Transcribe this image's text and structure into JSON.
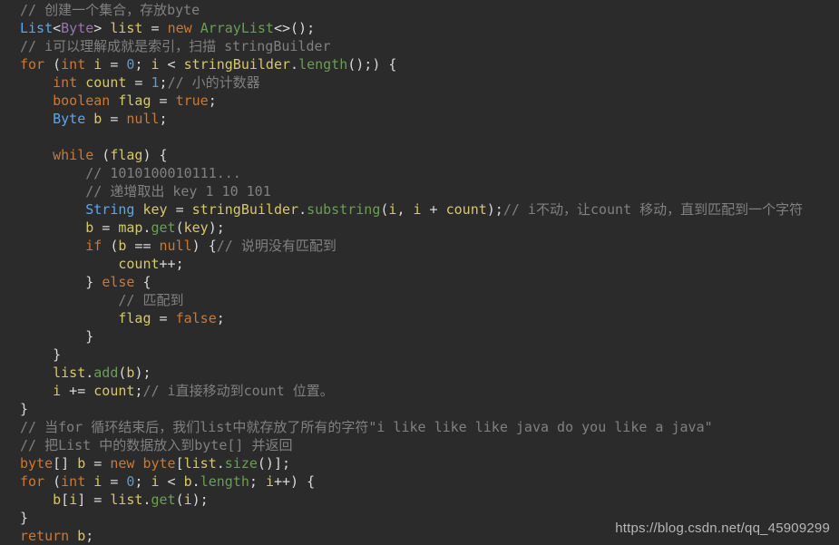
{
  "editor": {
    "background_color": "#2b2b2b",
    "language": "java",
    "theme": "darcula",
    "colors": {
      "comment": "#808080",
      "keyword": "#cc7832",
      "type": "#5ea6ea",
      "generic": "#9876aa",
      "identifier": "#d6c86a",
      "method": "#6a9e55",
      "number": "#6897bb",
      "punctuation": "#d9d9d9",
      "plain": "#a9b7c6"
    },
    "lines": [
      {
        "n": 1,
        "indent": 0,
        "tokens": [
          {
            "c": "comment",
            "t": "// 创建一个集合，存放byte"
          }
        ]
      },
      {
        "n": 2,
        "indent": 0,
        "tokens": [
          {
            "c": "type",
            "t": "List"
          },
          {
            "c": "punct",
            "t": "<"
          },
          {
            "c": "generic",
            "t": "Byte"
          },
          {
            "c": "punct",
            "t": "> "
          },
          {
            "c": "ident",
            "t": "list"
          },
          {
            "c": "op",
            "t": " = "
          },
          {
            "c": "keyword",
            "t": "new"
          },
          {
            "c": "plain",
            "t": " "
          },
          {
            "c": "method",
            "t": "ArrayList"
          },
          {
            "c": "punct",
            "t": "<>();"
          }
        ]
      },
      {
        "n": 3,
        "indent": 0,
        "tokens": [
          {
            "c": "comment",
            "t": "// i可以理解成就是索引，扫描 stringBuilder"
          }
        ]
      },
      {
        "n": 4,
        "indent": 0,
        "tokens": [
          {
            "c": "keyword",
            "t": "for"
          },
          {
            "c": "punct",
            "t": " ("
          },
          {
            "c": "keyword",
            "t": "int"
          },
          {
            "c": "plain",
            "t": " "
          },
          {
            "c": "ident",
            "t": "i"
          },
          {
            "c": "op",
            "t": " = "
          },
          {
            "c": "number",
            "t": "0"
          },
          {
            "c": "punct",
            "t": "; "
          },
          {
            "c": "ident",
            "t": "i"
          },
          {
            "c": "op",
            "t": " < "
          },
          {
            "c": "ident",
            "t": "stringBuilder"
          },
          {
            "c": "punct",
            "t": "."
          },
          {
            "c": "method",
            "t": "length"
          },
          {
            "c": "punct",
            "t": "();) {"
          }
        ]
      },
      {
        "n": 5,
        "indent": 1,
        "tokens": [
          {
            "c": "keyword",
            "t": "int"
          },
          {
            "c": "plain",
            "t": " "
          },
          {
            "c": "ident",
            "t": "count"
          },
          {
            "c": "op",
            "t": " = "
          },
          {
            "c": "number",
            "t": "1"
          },
          {
            "c": "punct",
            "t": ";"
          },
          {
            "c": "comment",
            "t": "// 小的计数器"
          }
        ]
      },
      {
        "n": 6,
        "indent": 1,
        "tokens": [
          {
            "c": "keyword",
            "t": "boolean"
          },
          {
            "c": "plain",
            "t": " "
          },
          {
            "c": "ident",
            "t": "flag"
          },
          {
            "c": "op",
            "t": " = "
          },
          {
            "c": "keyword",
            "t": "true"
          },
          {
            "c": "punct",
            "t": ";"
          }
        ]
      },
      {
        "n": 7,
        "indent": 1,
        "tokens": [
          {
            "c": "type",
            "t": "Byte"
          },
          {
            "c": "plain",
            "t": " "
          },
          {
            "c": "ident",
            "t": "b"
          },
          {
            "c": "op",
            "t": " = "
          },
          {
            "c": "keyword",
            "t": "null"
          },
          {
            "c": "punct",
            "t": ";"
          }
        ]
      },
      {
        "n": 8,
        "indent": 0,
        "tokens": []
      },
      {
        "n": 9,
        "indent": 1,
        "tokens": [
          {
            "c": "keyword",
            "t": "while"
          },
          {
            "c": "punct",
            "t": " ("
          },
          {
            "c": "ident",
            "t": "flag"
          },
          {
            "c": "punct",
            "t": ") {"
          }
        ]
      },
      {
        "n": 10,
        "indent": 2,
        "tokens": [
          {
            "c": "comment",
            "t": "// 1010100010111..."
          }
        ]
      },
      {
        "n": 11,
        "indent": 2,
        "tokens": [
          {
            "c": "comment",
            "t": "// 递增取出 key 1 10 101"
          }
        ]
      },
      {
        "n": 12,
        "indent": 2,
        "tokens": [
          {
            "c": "type",
            "t": "String"
          },
          {
            "c": "plain",
            "t": " "
          },
          {
            "c": "ident",
            "t": "key"
          },
          {
            "c": "op",
            "t": " = "
          },
          {
            "c": "ident",
            "t": "stringBuilder"
          },
          {
            "c": "punct",
            "t": "."
          },
          {
            "c": "method",
            "t": "substring"
          },
          {
            "c": "punct",
            "t": "("
          },
          {
            "c": "ident",
            "t": "i"
          },
          {
            "c": "punct",
            "t": ", "
          },
          {
            "c": "ident",
            "t": "i"
          },
          {
            "c": "op",
            "t": " + "
          },
          {
            "c": "ident",
            "t": "count"
          },
          {
            "c": "punct",
            "t": ");"
          },
          {
            "c": "comment",
            "t": "// i不动，让count 移动，直到匹配到一个字符"
          }
        ]
      },
      {
        "n": 13,
        "indent": 2,
        "tokens": [
          {
            "c": "ident",
            "t": "b"
          },
          {
            "c": "op",
            "t": " = "
          },
          {
            "c": "ident",
            "t": "map"
          },
          {
            "c": "punct",
            "t": "."
          },
          {
            "c": "method",
            "t": "get"
          },
          {
            "c": "punct",
            "t": "("
          },
          {
            "c": "ident",
            "t": "key"
          },
          {
            "c": "punct",
            "t": ");"
          }
        ]
      },
      {
        "n": 14,
        "indent": 2,
        "tokens": [
          {
            "c": "keyword",
            "t": "if"
          },
          {
            "c": "punct",
            "t": " ("
          },
          {
            "c": "ident",
            "t": "b"
          },
          {
            "c": "op",
            "t": " == "
          },
          {
            "c": "keyword",
            "t": "null"
          },
          {
            "c": "punct",
            "t": ") {"
          },
          {
            "c": "comment",
            "t": "// 说明没有匹配到"
          }
        ]
      },
      {
        "n": 15,
        "indent": 3,
        "tokens": [
          {
            "c": "ident",
            "t": "count"
          },
          {
            "c": "op",
            "t": "++"
          },
          {
            "c": "punct",
            "t": ";"
          }
        ]
      },
      {
        "n": 16,
        "indent": 2,
        "tokens": [
          {
            "c": "punct",
            "t": "} "
          },
          {
            "c": "keyword",
            "t": "else"
          },
          {
            "c": "punct",
            "t": " {"
          }
        ]
      },
      {
        "n": 17,
        "indent": 3,
        "tokens": [
          {
            "c": "comment",
            "t": "// 匹配到"
          }
        ]
      },
      {
        "n": 18,
        "indent": 3,
        "tokens": [
          {
            "c": "ident",
            "t": "flag"
          },
          {
            "c": "op",
            "t": " = "
          },
          {
            "c": "keyword",
            "t": "false"
          },
          {
            "c": "punct",
            "t": ";"
          }
        ]
      },
      {
        "n": 19,
        "indent": 2,
        "tokens": [
          {
            "c": "punct",
            "t": "}"
          }
        ]
      },
      {
        "n": 20,
        "indent": 1,
        "tokens": [
          {
            "c": "punct",
            "t": "}"
          }
        ]
      },
      {
        "n": 21,
        "indent": 1,
        "tokens": [
          {
            "c": "ident",
            "t": "list"
          },
          {
            "c": "punct",
            "t": "."
          },
          {
            "c": "method",
            "t": "add"
          },
          {
            "c": "punct",
            "t": "("
          },
          {
            "c": "ident",
            "t": "b"
          },
          {
            "c": "punct",
            "t": ");"
          }
        ]
      },
      {
        "n": 22,
        "indent": 1,
        "tokens": [
          {
            "c": "ident",
            "t": "i"
          },
          {
            "c": "op",
            "t": " += "
          },
          {
            "c": "ident",
            "t": "count"
          },
          {
            "c": "punct",
            "t": ";"
          },
          {
            "c": "comment",
            "t": "// i直接移动到count 位置。"
          }
        ]
      },
      {
        "n": 23,
        "indent": 0,
        "tokens": [
          {
            "c": "punct",
            "t": "}"
          }
        ]
      },
      {
        "n": 24,
        "indent": 0,
        "tokens": [
          {
            "c": "comment",
            "t": "// 当for 循环结束后，我们list中就存放了所有的字符\"i like like like java do you like a java\""
          }
        ]
      },
      {
        "n": 25,
        "indent": 0,
        "tokens": [
          {
            "c": "comment",
            "t": "// 把List 中的数据放入到byte[] 并返回"
          }
        ]
      },
      {
        "n": 26,
        "indent": 0,
        "tokens": [
          {
            "c": "keyword",
            "t": "byte"
          },
          {
            "c": "punct",
            "t": "[] "
          },
          {
            "c": "ident",
            "t": "b"
          },
          {
            "c": "op",
            "t": " = "
          },
          {
            "c": "keyword",
            "t": "new"
          },
          {
            "c": "plain",
            "t": " "
          },
          {
            "c": "keyword",
            "t": "byte"
          },
          {
            "c": "punct",
            "t": "["
          },
          {
            "c": "ident",
            "t": "list"
          },
          {
            "c": "punct",
            "t": "."
          },
          {
            "c": "method",
            "t": "size"
          },
          {
            "c": "punct",
            "t": "()];"
          }
        ]
      },
      {
        "n": 27,
        "indent": 0,
        "tokens": [
          {
            "c": "keyword",
            "t": "for"
          },
          {
            "c": "punct",
            "t": " ("
          },
          {
            "c": "keyword",
            "t": "int"
          },
          {
            "c": "plain",
            "t": " "
          },
          {
            "c": "ident",
            "t": "i"
          },
          {
            "c": "op",
            "t": " = "
          },
          {
            "c": "number",
            "t": "0"
          },
          {
            "c": "punct",
            "t": "; "
          },
          {
            "c": "ident",
            "t": "i"
          },
          {
            "c": "op",
            "t": " < "
          },
          {
            "c": "ident",
            "t": "b"
          },
          {
            "c": "punct",
            "t": "."
          },
          {
            "c": "method",
            "t": "length"
          },
          {
            "c": "punct",
            "t": "; "
          },
          {
            "c": "ident",
            "t": "i"
          },
          {
            "c": "op",
            "t": "++"
          },
          {
            "c": "punct",
            "t": ") {"
          }
        ]
      },
      {
        "n": 28,
        "indent": 1,
        "tokens": [
          {
            "c": "ident",
            "t": "b"
          },
          {
            "c": "punct",
            "t": "["
          },
          {
            "c": "ident",
            "t": "i"
          },
          {
            "c": "punct",
            "t": "]"
          },
          {
            "c": "op",
            "t": " = "
          },
          {
            "c": "ident",
            "t": "list"
          },
          {
            "c": "punct",
            "t": "."
          },
          {
            "c": "method",
            "t": "get"
          },
          {
            "c": "punct",
            "t": "("
          },
          {
            "c": "ident",
            "t": "i"
          },
          {
            "c": "punct",
            "t": ");"
          }
        ]
      },
      {
        "n": 29,
        "indent": 0,
        "tokens": [
          {
            "c": "punct",
            "t": "}"
          }
        ]
      },
      {
        "n": 30,
        "indent": 0,
        "tokens": [
          {
            "c": "keyword",
            "t": "return"
          },
          {
            "c": "plain",
            "t": " "
          },
          {
            "c": "ident",
            "t": "b"
          },
          {
            "c": "punct",
            "t": ";"
          }
        ]
      }
    ]
  },
  "watermark": {
    "text": "https://blog.csdn.net/qq_45909299",
    "color": "#b6b6b6"
  }
}
